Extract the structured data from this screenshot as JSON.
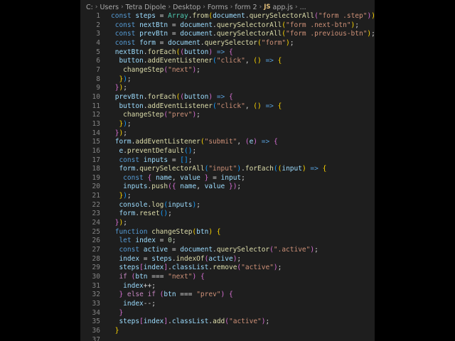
{
  "breadcrumb": {
    "items": [
      "C:",
      "Users",
      "Tetra Dipole",
      "Desktop",
      "Forms",
      "form 2"
    ],
    "file_icon": "JS",
    "file": "app.js",
    "trailing": "..."
  },
  "code_lines": [
    {
      "n": "1",
      "t": [
        [
          "k",
          "const "
        ],
        [
          "v",
          "steps"
        ],
        [
          "p",
          " = "
        ],
        [
          "c",
          "Array"
        ],
        [
          "p",
          "."
        ],
        [
          "f",
          "from"
        ],
        [
          "b1",
          "("
        ],
        [
          "v",
          "document"
        ],
        [
          "p",
          "."
        ],
        [
          "f",
          "querySelectorAll"
        ],
        [
          "b2",
          "("
        ],
        [
          "s",
          "\"form .step\""
        ],
        [
          "b2",
          ")"
        ],
        [
          "b1",
          ")"
        ],
        [
          "p",
          ";"
        ]
      ]
    },
    {
      "n": "2",
      "t": [
        [
          "p",
          " "
        ],
        [
          "k",
          "const "
        ],
        [
          "v",
          "nextBtn"
        ],
        [
          "p",
          " = "
        ],
        [
          "v",
          "document"
        ],
        [
          "p",
          "."
        ],
        [
          "f",
          "querySelectorAll"
        ],
        [
          "b1",
          "("
        ],
        [
          "s",
          "\"form .next-btn\""
        ],
        [
          "b1",
          ")"
        ],
        [
          "p",
          ";"
        ]
      ]
    },
    {
      "n": "3",
      "t": [
        [
          "p",
          " "
        ],
        [
          "k",
          "const "
        ],
        [
          "v",
          "prevBtn"
        ],
        [
          "p",
          " = "
        ],
        [
          "v",
          "document"
        ],
        [
          "p",
          "."
        ],
        [
          "f",
          "querySelectorAll"
        ],
        [
          "b1",
          "("
        ],
        [
          "s",
          "\"form .previous-btn\""
        ],
        [
          "b1",
          ")"
        ],
        [
          "p",
          ";"
        ]
      ]
    },
    {
      "n": "4",
      "t": [
        [
          "p",
          " "
        ],
        [
          "k",
          "const "
        ],
        [
          "v",
          "form"
        ],
        [
          "p",
          " = "
        ],
        [
          "v",
          "document"
        ],
        [
          "p",
          "."
        ],
        [
          "f",
          "querySelector"
        ],
        [
          "b1",
          "("
        ],
        [
          "s",
          "\"form\""
        ],
        [
          "b1",
          ")"
        ],
        [
          "p",
          ";"
        ]
      ]
    },
    {
      "n": "5",
      "t": [
        [
          "p",
          " "
        ],
        [
          "v",
          "nextBtn"
        ],
        [
          "p",
          "."
        ],
        [
          "f",
          "forEach"
        ],
        [
          "b1",
          "("
        ],
        [
          "b2",
          "("
        ],
        [
          "v",
          "button"
        ],
        [
          "b2",
          ")"
        ],
        [
          "k",
          " =>"
        ],
        [
          "p",
          " "
        ],
        [
          "b2",
          "{"
        ]
      ]
    },
    {
      "n": "6",
      "t": [
        [
          "p",
          "  "
        ],
        [
          "v",
          "button"
        ],
        [
          "p",
          "."
        ],
        [
          "f",
          "addEventListener"
        ],
        [
          "b3",
          "("
        ],
        [
          "s",
          "\"click\""
        ],
        [
          "p",
          ", "
        ],
        [
          "b1",
          "()"
        ],
        [
          "k",
          " =>"
        ],
        [
          "p",
          " "
        ],
        [
          "b1",
          "{"
        ]
      ]
    },
    {
      "n": "7",
      "t": [
        [
          "p",
          "   "
        ],
        [
          "f",
          "changeStep"
        ],
        [
          "b2",
          "("
        ],
        [
          "s",
          "\"next\""
        ],
        [
          "b2",
          ")"
        ],
        [
          "p",
          ";"
        ]
      ]
    },
    {
      "n": "8",
      "t": [
        [
          "p",
          "  "
        ],
        [
          "b1",
          "}"
        ],
        [
          "b3",
          ")"
        ],
        [
          "p",
          ";"
        ]
      ]
    },
    {
      "n": "9",
      "t": [
        [
          "p",
          " "
        ],
        [
          "b2",
          "}"
        ],
        [
          "b1",
          ")"
        ],
        [
          "p",
          ";"
        ]
      ]
    },
    {
      "n": "10",
      "t": [
        [
          "p",
          " "
        ],
        [
          "v",
          "prevBtn"
        ],
        [
          "p",
          "."
        ],
        [
          "f",
          "forEach"
        ],
        [
          "b1",
          "("
        ],
        [
          "b2",
          "("
        ],
        [
          "v",
          "button"
        ],
        [
          "b2",
          ")"
        ],
        [
          "k",
          " =>"
        ],
        [
          "p",
          " "
        ],
        [
          "b2",
          "{"
        ]
      ]
    },
    {
      "n": "11",
      "t": [
        [
          "p",
          "  "
        ],
        [
          "v",
          "button"
        ],
        [
          "p",
          "."
        ],
        [
          "f",
          "addEventListener"
        ],
        [
          "b3",
          "("
        ],
        [
          "s",
          "\"click\""
        ],
        [
          "p",
          ", "
        ],
        [
          "b1",
          "()"
        ],
        [
          "k",
          " =>"
        ],
        [
          "p",
          " "
        ],
        [
          "b1",
          "{"
        ]
      ]
    },
    {
      "n": "12",
      "t": [
        [
          "p",
          "   "
        ],
        [
          "f",
          "changeStep"
        ],
        [
          "b2",
          "("
        ],
        [
          "s",
          "\"prev\""
        ],
        [
          "b2",
          ")"
        ],
        [
          "p",
          ";"
        ]
      ]
    },
    {
      "n": "13",
      "t": [
        [
          "p",
          "  "
        ],
        [
          "b1",
          "}"
        ],
        [
          "b3",
          ")"
        ],
        [
          "p",
          ";"
        ]
      ]
    },
    {
      "n": "14",
      "t": [
        [
          "p",
          " "
        ],
        [
          "b2",
          "}"
        ],
        [
          "b1",
          ")"
        ],
        [
          "p",
          ";"
        ]
      ]
    },
    {
      "n": "15",
      "t": [
        [
          "p",
          " "
        ],
        [
          "v",
          "form"
        ],
        [
          "p",
          "."
        ],
        [
          "f",
          "addEventListener"
        ],
        [
          "b1",
          "("
        ],
        [
          "s",
          "\"submit\""
        ],
        [
          "p",
          ", "
        ],
        [
          "b2",
          "("
        ],
        [
          "v",
          "e"
        ],
        [
          "b2",
          ")"
        ],
        [
          "k",
          " =>"
        ],
        [
          "p",
          " "
        ],
        [
          "b2",
          "{"
        ]
      ]
    },
    {
      "n": "16",
      "t": [
        [
          "p",
          "  "
        ],
        [
          "v",
          "e"
        ],
        [
          "p",
          "."
        ],
        [
          "f",
          "preventDefault"
        ],
        [
          "b3",
          "()"
        ],
        [
          "p",
          ";"
        ]
      ]
    },
    {
      "n": "17",
      "t": [
        [
          "p",
          "  "
        ],
        [
          "k",
          "const "
        ],
        [
          "v",
          "inputs"
        ],
        [
          "p",
          " = "
        ],
        [
          "b3",
          "[]"
        ],
        [
          "p",
          ";"
        ]
      ]
    },
    {
      "n": "18",
      "t": [
        [
          "p",
          "  "
        ],
        [
          "v",
          "form"
        ],
        [
          "p",
          "."
        ],
        [
          "f",
          "querySelectorAll"
        ],
        [
          "b3",
          "("
        ],
        [
          "s",
          "\"input\""
        ],
        [
          "b3",
          ")"
        ],
        [
          "p",
          "."
        ],
        [
          "f",
          "forEach"
        ],
        [
          "b3",
          "("
        ],
        [
          "b1",
          "("
        ],
        [
          "v",
          "input"
        ],
        [
          "b1",
          ")"
        ],
        [
          "k",
          " =>"
        ],
        [
          "p",
          " "
        ],
        [
          "b1",
          "{"
        ]
      ]
    },
    {
      "n": "19",
      "t": [
        [
          "p",
          "   "
        ],
        [
          "k",
          "const "
        ],
        [
          "b2",
          "{ "
        ],
        [
          "v",
          "name"
        ],
        [
          "p",
          ", "
        ],
        [
          "v",
          "value"
        ],
        [
          "b2",
          " }"
        ],
        [
          "p",
          " = "
        ],
        [
          "v",
          "input"
        ],
        [
          "p",
          ";"
        ]
      ]
    },
    {
      "n": "20",
      "t": [
        [
          "p",
          "   "
        ],
        [
          "v",
          "inputs"
        ],
        [
          "p",
          "."
        ],
        [
          "f",
          "push"
        ],
        [
          "b2",
          "({ "
        ],
        [
          "v",
          "name"
        ],
        [
          "p",
          ", "
        ],
        [
          "v",
          "value"
        ],
        [
          "b2",
          " })"
        ],
        [
          "p",
          ";"
        ]
      ]
    },
    {
      "n": "21",
      "t": [
        [
          "p",
          "  "
        ],
        [
          "b1",
          "}"
        ],
        [
          "b3",
          ")"
        ],
        [
          "p",
          ";"
        ]
      ]
    },
    {
      "n": "22",
      "t": [
        [
          "p",
          "  "
        ],
        [
          "v",
          "console"
        ],
        [
          "p",
          "."
        ],
        [
          "f",
          "log"
        ],
        [
          "b3",
          "("
        ],
        [
          "v",
          "inputs"
        ],
        [
          "b3",
          ")"
        ],
        [
          "p",
          ";"
        ]
      ]
    },
    {
      "n": "23",
      "t": [
        [
          "p",
          "  "
        ],
        [
          "v",
          "form"
        ],
        [
          "p",
          "."
        ],
        [
          "f",
          "reset"
        ],
        [
          "b3",
          "()"
        ],
        [
          "p",
          ";"
        ]
      ]
    },
    {
      "n": "24",
      "t": [
        [
          "p",
          " "
        ],
        [
          "b2",
          "}"
        ],
        [
          "b1",
          ")"
        ],
        [
          "p",
          ";"
        ]
      ]
    },
    {
      "n": "25",
      "t": [
        [
          "p",
          " "
        ],
        [
          "k",
          "function "
        ],
        [
          "f",
          "changeStep"
        ],
        [
          "b1",
          "("
        ],
        [
          "v",
          "btn"
        ],
        [
          "b1",
          ")"
        ],
        [
          "p",
          " "
        ],
        [
          "b1",
          "{"
        ]
      ]
    },
    {
      "n": "26",
      "t": [
        [
          "p",
          "  "
        ],
        [
          "k",
          "let "
        ],
        [
          "v",
          "index"
        ],
        [
          "p",
          " = "
        ],
        [
          "n",
          "0"
        ],
        [
          "p",
          ";"
        ]
      ]
    },
    {
      "n": "27",
      "t": [
        [
          "p",
          "  "
        ],
        [
          "k",
          "const "
        ],
        [
          "v",
          "active"
        ],
        [
          "p",
          " = "
        ],
        [
          "v",
          "document"
        ],
        [
          "p",
          "."
        ],
        [
          "f",
          "querySelector"
        ],
        [
          "b2",
          "("
        ],
        [
          "s",
          "\".active\""
        ],
        [
          "b2",
          ")"
        ],
        [
          "p",
          ";"
        ]
      ]
    },
    {
      "n": "28",
      "t": [
        [
          "p",
          "  "
        ],
        [
          "v",
          "index"
        ],
        [
          "p",
          " = "
        ],
        [
          "v",
          "steps"
        ],
        [
          "p",
          "."
        ],
        [
          "f",
          "indexOf"
        ],
        [
          "b2",
          "("
        ],
        [
          "v",
          "active"
        ],
        [
          "b2",
          ")"
        ],
        [
          "p",
          ";"
        ]
      ]
    },
    {
      "n": "29",
      "t": [
        [
          "p",
          "  "
        ],
        [
          "v",
          "steps"
        ],
        [
          "b2",
          "["
        ],
        [
          "v",
          "index"
        ],
        [
          "b2",
          "]"
        ],
        [
          "p",
          "."
        ],
        [
          "v",
          "classList"
        ],
        [
          "p",
          "."
        ],
        [
          "f",
          "remove"
        ],
        [
          "b2",
          "("
        ],
        [
          "s",
          "\"active\""
        ],
        [
          "b2",
          ")"
        ],
        [
          "p",
          ";"
        ]
      ]
    },
    {
      "n": "30",
      "t": [
        [
          "p",
          "  "
        ],
        [
          "cf",
          "if "
        ],
        [
          "b2",
          "("
        ],
        [
          "v",
          "btn"
        ],
        [
          "p",
          " === "
        ],
        [
          "s",
          "\"next\""
        ],
        [
          "b2",
          ")"
        ],
        [
          "p",
          " "
        ],
        [
          "b2",
          "{"
        ]
      ]
    },
    {
      "n": "31",
      "t": [
        [
          "p",
          "   "
        ],
        [
          "v",
          "index"
        ],
        [
          "p",
          "++;"
        ]
      ]
    },
    {
      "n": "32",
      "t": [
        [
          "p",
          "  "
        ],
        [
          "b2",
          "}"
        ],
        [
          "cf",
          " else if "
        ],
        [
          "b2",
          "("
        ],
        [
          "v",
          "btn"
        ],
        [
          "p",
          " === "
        ],
        [
          "s",
          "\"prev\""
        ],
        [
          "b2",
          ")"
        ],
        [
          "p",
          " "
        ],
        [
          "b2",
          "{"
        ]
      ]
    },
    {
      "n": "33",
      "t": [
        [
          "p",
          "   "
        ],
        [
          "v",
          "index"
        ],
        [
          "p",
          "--;"
        ]
      ]
    },
    {
      "n": "34",
      "t": [
        [
          "p",
          "  "
        ],
        [
          "b2",
          "}"
        ]
      ]
    },
    {
      "n": "35",
      "t": [
        [
          "p",
          "  "
        ],
        [
          "v",
          "steps"
        ],
        [
          "b2",
          "["
        ],
        [
          "v",
          "index"
        ],
        [
          "b2",
          "]"
        ],
        [
          "p",
          "."
        ],
        [
          "v",
          "classList"
        ],
        [
          "p",
          "."
        ],
        [
          "f",
          "add"
        ],
        [
          "b2",
          "("
        ],
        [
          "s",
          "\"active\""
        ],
        [
          "b2",
          ")"
        ],
        [
          "p",
          ";"
        ]
      ]
    },
    {
      "n": "36",
      "t": [
        [
          "p",
          " "
        ],
        [
          "b1",
          "}"
        ]
      ]
    },
    {
      "n": "37",
      "t": []
    }
  ]
}
